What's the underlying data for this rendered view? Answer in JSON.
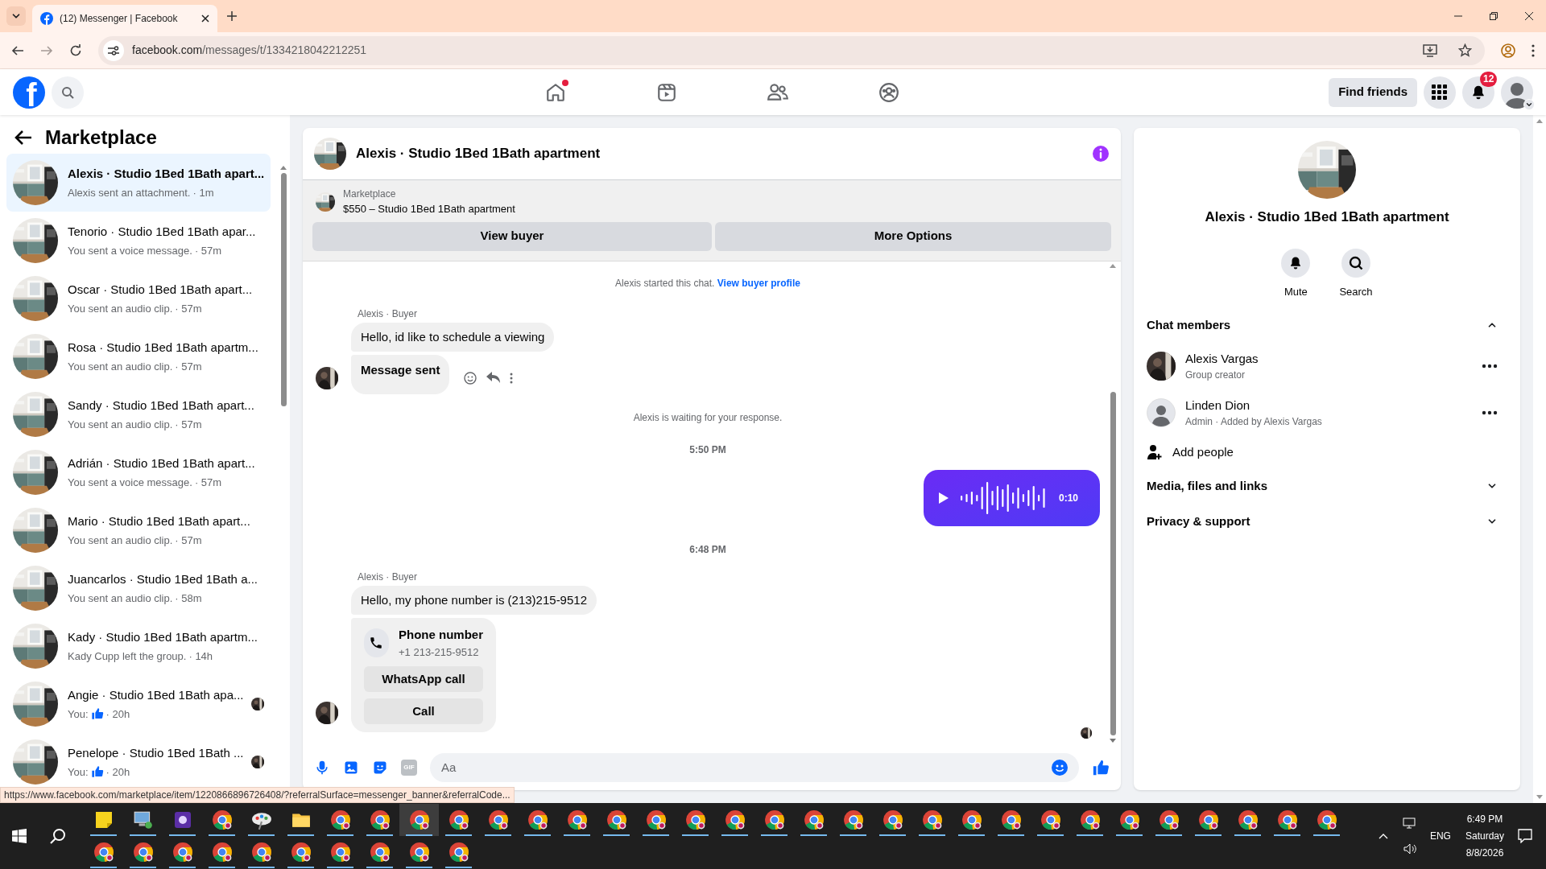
{
  "browser": {
    "tab_title": "(12) Messenger | Facebook",
    "url_host": "facebook.com",
    "url_path": "/messages/t/1334218042212251",
    "status_url": "https://www.facebook.com/marketplace/item/1220866896726408/?referralSurface=messenger_banner&referralCode..."
  },
  "header": {
    "logo_text": "f",
    "nav": [
      {
        "kind": "home",
        "dot": true
      },
      {
        "kind": "video",
        "dot": false
      },
      {
        "kind": "friends",
        "dot": false
      },
      {
        "kind": "groups",
        "dot": false
      }
    ],
    "find_friends": "Find friends",
    "notification_count": "12"
  },
  "sidebar": {
    "title": "Marketplace",
    "items": [
      {
        "title": "Alexis · Studio 1Bed 1Bath apart...",
        "preview": "Alexis sent an attachment.",
        "like": false,
        "time": "· 1m",
        "seen": false,
        "selected": true
      },
      {
        "title": "Tenorio · Studio 1Bed 1Bath apar...",
        "preview": "You sent a voice message.",
        "like": false,
        "time": "· 57m",
        "seen": false,
        "selected": false
      },
      {
        "title": "Oscar · Studio 1Bed 1Bath apart...",
        "preview": "You sent an audio clip.",
        "like": false,
        "time": "· 57m",
        "seen": false,
        "selected": false
      },
      {
        "title": "Rosa · Studio 1Bed 1Bath apartm...",
        "preview": "You sent an audio clip.",
        "like": false,
        "time": "· 57m",
        "seen": false,
        "selected": false
      },
      {
        "title": "Sandy · Studio 1Bed 1Bath apart...",
        "preview": "You sent an audio clip.",
        "like": false,
        "time": "· 57m",
        "seen": false,
        "selected": false
      },
      {
        "title": "Adrián · Studio 1Bed 1Bath apart...",
        "preview": "You sent a voice message.",
        "like": false,
        "time": "· 57m",
        "seen": false,
        "selected": false
      },
      {
        "title": "Mario · Studio 1Bed 1Bath apart...",
        "preview": "You sent an audio clip.",
        "like": false,
        "time": "· 57m",
        "seen": false,
        "selected": false
      },
      {
        "title": "Juancarlos · Studio 1Bed 1Bath a...",
        "preview": "You sent an audio clip.",
        "like": false,
        "time": "· 58m",
        "seen": false,
        "selected": false
      },
      {
        "title": "Kady · Studio 1Bed 1Bath apartm...",
        "preview": "Kady Cupp left the group.",
        "like": false,
        "time": "· 14h",
        "seen": false,
        "selected": false
      },
      {
        "title": "Angie · Studio 1Bed 1Bath apa...",
        "preview": "You:",
        "like": true,
        "time": "· 20h",
        "seen": true,
        "selected": false
      },
      {
        "title": "Penelope · Studio 1Bed 1Bath ...",
        "preview": "You:",
        "like": true,
        "time": "· 20h",
        "seen": true,
        "selected": false
      }
    ]
  },
  "chat": {
    "title": "Alexis · Studio 1Bed 1Bath apartment",
    "banner": {
      "label": "Marketplace",
      "listing": "$550 – Studio 1Bed 1Bath apartment",
      "buttons": [
        "View buyer",
        "More Options"
      ]
    },
    "messages": [
      {
        "kind": "system",
        "text": "Alexis started this chat.",
        "link": "View buyer profile"
      },
      {
        "kind": "sender",
        "text": "Alexis · Buyer"
      },
      {
        "kind": "incoming",
        "text": "Hello, id like to schedule a viewing",
        "avatar": false
      },
      {
        "kind": "incoming_bold",
        "text": "Message sent",
        "avatar": true
      },
      {
        "kind": "status",
        "text": "Alexis is waiting for your response."
      },
      {
        "kind": "time",
        "text": "5:50 PM"
      },
      {
        "kind": "voice",
        "text": "0:10"
      },
      {
        "kind": "time",
        "text": "6:48 PM"
      },
      {
        "kind": "sender",
        "text": "Alexis · Buyer"
      },
      {
        "kind": "incoming",
        "text": "Hello, my phone number is (213)215-9512",
        "avatar": false
      },
      {
        "kind": "phone_card",
        "title": "Phone number",
        "number": "+1 213-215-9512",
        "buttons": [
          "WhatsApp call",
          "Call"
        ],
        "avatar": true
      }
    ],
    "composer": {
      "gif_label": "GIF",
      "placeholder": "Aa"
    }
  },
  "details": {
    "title": "Alexis · Studio 1Bed 1Bath apartment",
    "actions": [
      {
        "kind": "mute",
        "label": "Mute"
      },
      {
        "kind": "search",
        "label": "Search"
      }
    ],
    "sections": [
      {
        "title": "Chat members",
        "expanded": true,
        "members": [
          {
            "name": "Alexis Vargas",
            "role": "Group creator",
            "photo": true
          },
          {
            "name": "Linden Dion",
            "role": "Admin · Added by Alexis Vargas",
            "photo": false
          }
        ],
        "add_label": "Add people"
      },
      {
        "title": "Media, files and links",
        "expanded": false
      },
      {
        "title": "Privacy & support",
        "expanded": false
      }
    ]
  },
  "taskbar": {
    "apps": [
      {
        "kind": "notes",
        "selected": false
      },
      {
        "kind": "computer",
        "selected": false
      },
      {
        "kind": "purple",
        "selected": false
      },
      {
        "kind": "chrome",
        "selected": false
      },
      {
        "kind": "paint",
        "selected": false
      },
      {
        "kind": "folder",
        "selected": false
      },
      {
        "kind": "chrome",
        "selected": false
      },
      {
        "kind": "chrome",
        "selected": false
      },
      {
        "kind": "chrome",
        "selected": true
      },
      {
        "kind": "chrome",
        "selected": false
      },
      {
        "kind": "chrome",
        "selected": false
      },
      {
        "kind": "chrome",
        "selected": false
      },
      {
        "kind": "chrome",
        "selected": false
      },
      {
        "kind": "chrome",
        "selected": false
      },
      {
        "kind": "chrome",
        "selected": false
      },
      {
        "kind": "chrome",
        "selected": false
      },
      {
        "kind": "chrome",
        "selected": false
      },
      {
        "kind": "chrome",
        "selected": false
      },
      {
        "kind": "chrome",
        "selected": false
      },
      {
        "kind": "chrome",
        "selected": false
      },
      {
        "kind": "chrome",
        "selected": false
      },
      {
        "kind": "chrome",
        "selected": false
      },
      {
        "kind": "chrome",
        "selected": false
      },
      {
        "kind": "chrome",
        "selected": false
      },
      {
        "kind": "chrome",
        "selected": false
      },
      {
        "kind": "chrome",
        "selected": false
      },
      {
        "kind": "chrome",
        "selected": false
      },
      {
        "kind": "chrome",
        "selected": false
      },
      {
        "kind": "chrome",
        "selected": false
      },
      {
        "kind": "chrome",
        "selected": false
      },
      {
        "kind": "chrome",
        "selected": false
      },
      {
        "kind": "chrome",
        "selected": false
      },
      {
        "kind": "chrome",
        "selected": false
      },
      {
        "kind": "chrome",
        "selected": false
      },
      {
        "kind": "chrome",
        "selected": false
      },
      {
        "kind": "chrome",
        "selected": false
      },
      {
        "kind": "chrome",
        "selected": false
      },
      {
        "kind": "chrome",
        "selected": false
      },
      {
        "kind": "chrome",
        "selected": false
      },
      {
        "kind": "chrome",
        "selected": false
      },
      {
        "kind": "chrome",
        "selected": false
      },
      {
        "kind": "chrome",
        "selected": false
      }
    ],
    "language": "ENG",
    "time": "6:49 PM",
    "day": "Saturday",
    "date": "8/8/2026"
  }
}
